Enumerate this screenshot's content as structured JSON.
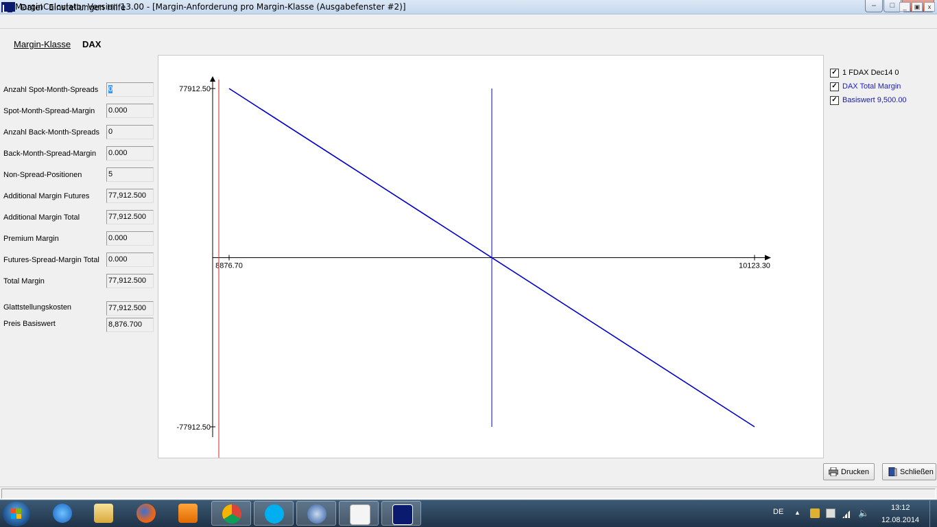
{
  "window": {
    "title": "MarginCalculator Version 13.00 - [Margin-Anforderung pro Margin-Klasse (Ausgabefenster #2)]",
    "min_symbol": "–",
    "max_symbol": "□",
    "close_symbol": "X"
  },
  "menu": {
    "items": [
      "Datei",
      "Einstellungen",
      "Hilfe"
    ],
    "mdi_min": "_",
    "mdi_restore": "▣",
    "mdi_close": "x"
  },
  "header": {
    "label": "Margin-Klasse",
    "value": "DAX"
  },
  "fields": [
    {
      "label": "Anzahl Spot-Month-Spreads",
      "value": "0"
    },
    {
      "label": "Spot-Month-Spread-Margin",
      "value": "0.000"
    },
    {
      "label": "Anzahl Back-Month-Spreads",
      "value": "0"
    },
    {
      "label": "Back-Month-Spread-Margin",
      "value": "0.000"
    },
    {
      "label": "Non-Spread-Positionen",
      "value": "5"
    },
    {
      "label": "Additional Margin Futures",
      "value": "77,912.500"
    },
    {
      "label": "Additional Margin Total",
      "value": "77,912.500"
    },
    {
      "label": "Premium Margin",
      "value": "0.000"
    },
    {
      "label": "Futures-Spread-Margin Total",
      "value": "0.000"
    },
    {
      "label": "Total Margin",
      "value": "77,912.500"
    },
    {
      "label": "Glattstellungskosten",
      "value": "77,912.500"
    },
    {
      "label": "Preis Basiswert",
      "value": "8,876.700"
    }
  ],
  "chart_data": {
    "type": "line",
    "xlim": [
      8876.7,
      10123.3
    ],
    "ylim": [
      -77912.5,
      77912.5
    ],
    "x_tick_labels": [
      "8876.70",
      "10123.30"
    ],
    "y_tick_labels": [
      "77912.50",
      "-77912.50"
    ],
    "series": [
      {
        "name": "DAX Total Margin",
        "color": "#0000cc",
        "x": [
          8876.7,
          10123.3
        ],
        "y": [
          77912.5,
          -77912.5
        ]
      }
    ],
    "vertical_markers": [
      {
        "name": "Basiswert 9,500.00",
        "x": 9500.0,
        "color": "#0000aa"
      },
      {
        "x": 8876.7,
        "color": "#dd2222"
      }
    ]
  },
  "legend": [
    {
      "label": "1 FDAX Dec14 0",
      "checked": true,
      "color": "#000000"
    },
    {
      "label": "DAX Total Margin",
      "checked": true,
      "color": "#1a1ad6"
    },
    {
      "label": "Basiswert 9,500.00",
      "checked": true,
      "color": "#1a1aa6"
    }
  ],
  "buttons": {
    "print": "Drucken",
    "close": "Schließen"
  },
  "taskbar": {
    "apps": [
      "internet-explorer",
      "file-explorer",
      "firefox",
      "media-player",
      "chrome",
      "skype",
      "thunderbird",
      "document-viewer",
      "margin-calculator"
    ],
    "lang": "DE",
    "time": "13:12",
    "date": "12.08.2014"
  }
}
